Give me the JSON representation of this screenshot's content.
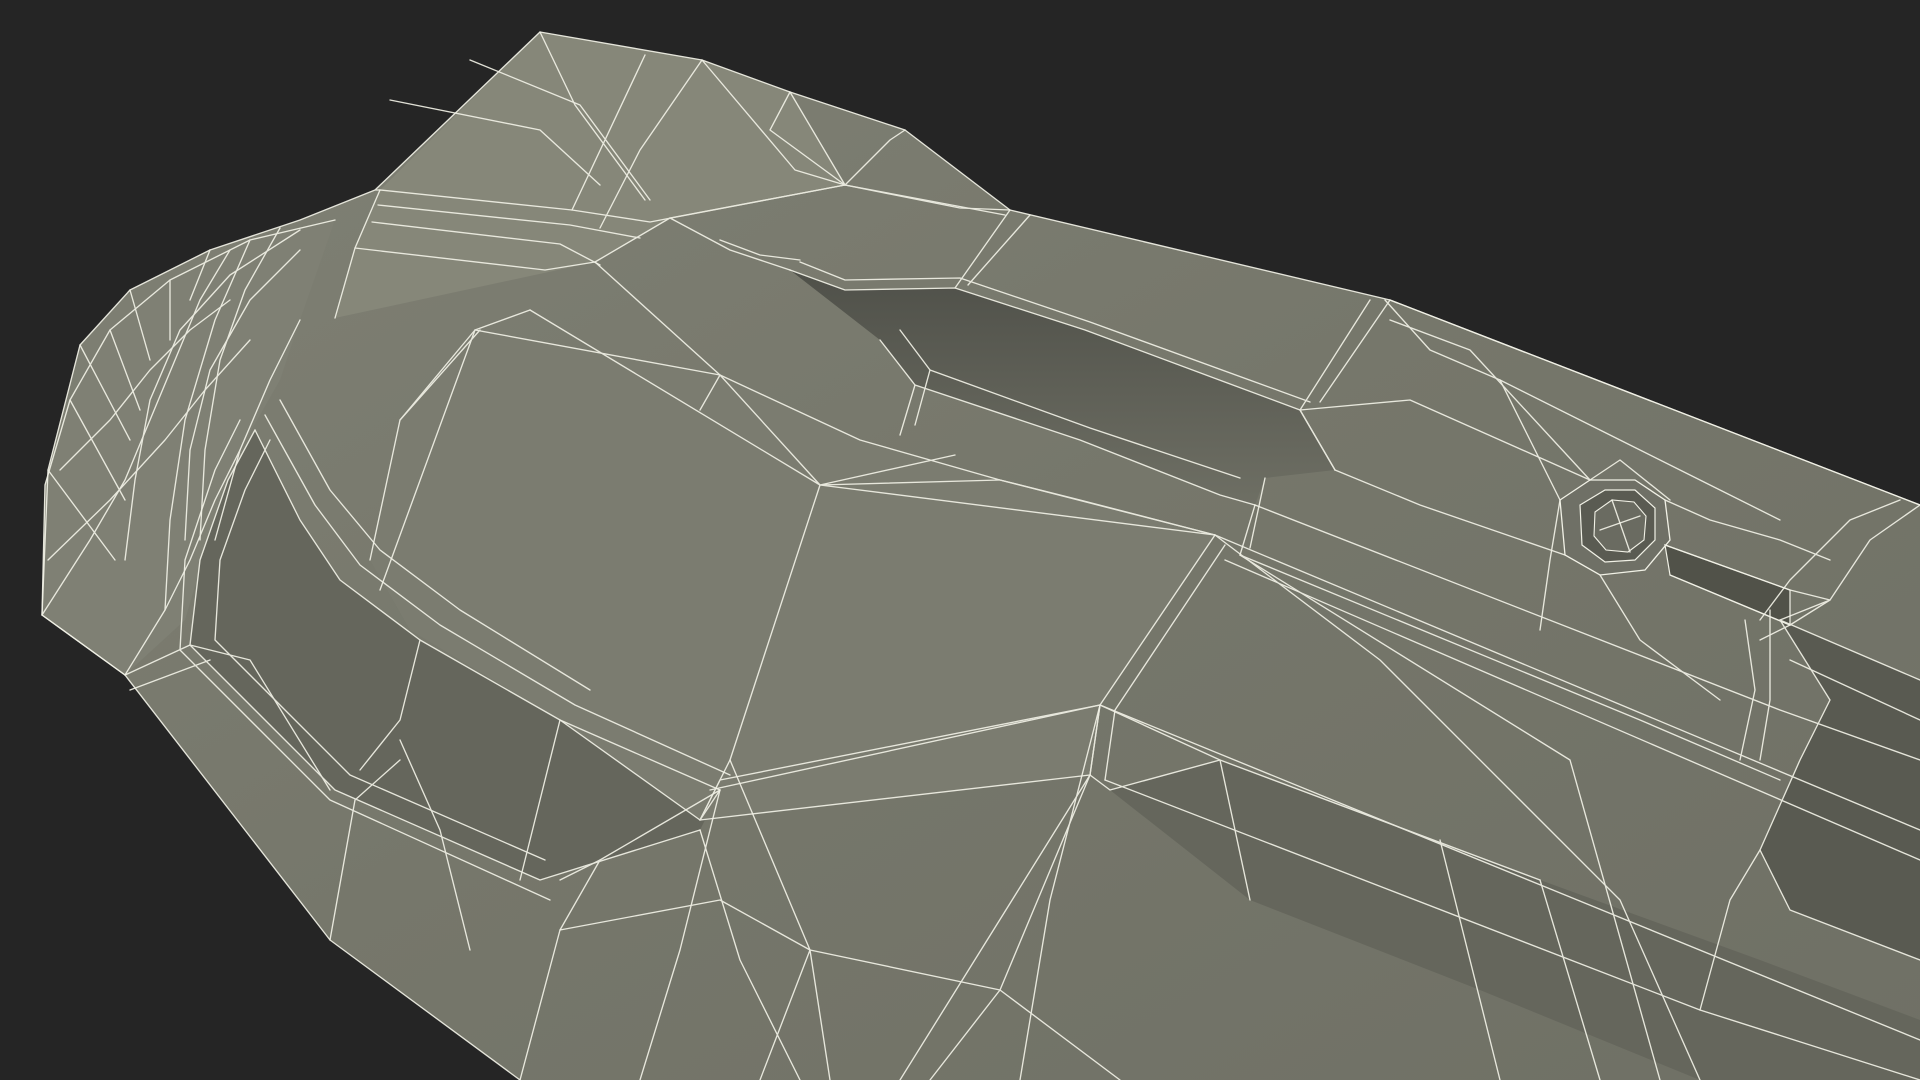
{
  "scene": {
    "subject": "wireframe-3d-model",
    "colors": {
      "background": "#252525",
      "surface": "#7a7b6f",
      "surface_shadow": "#65665c",
      "wireframe": "#f1f1e6"
    }
  }
}
